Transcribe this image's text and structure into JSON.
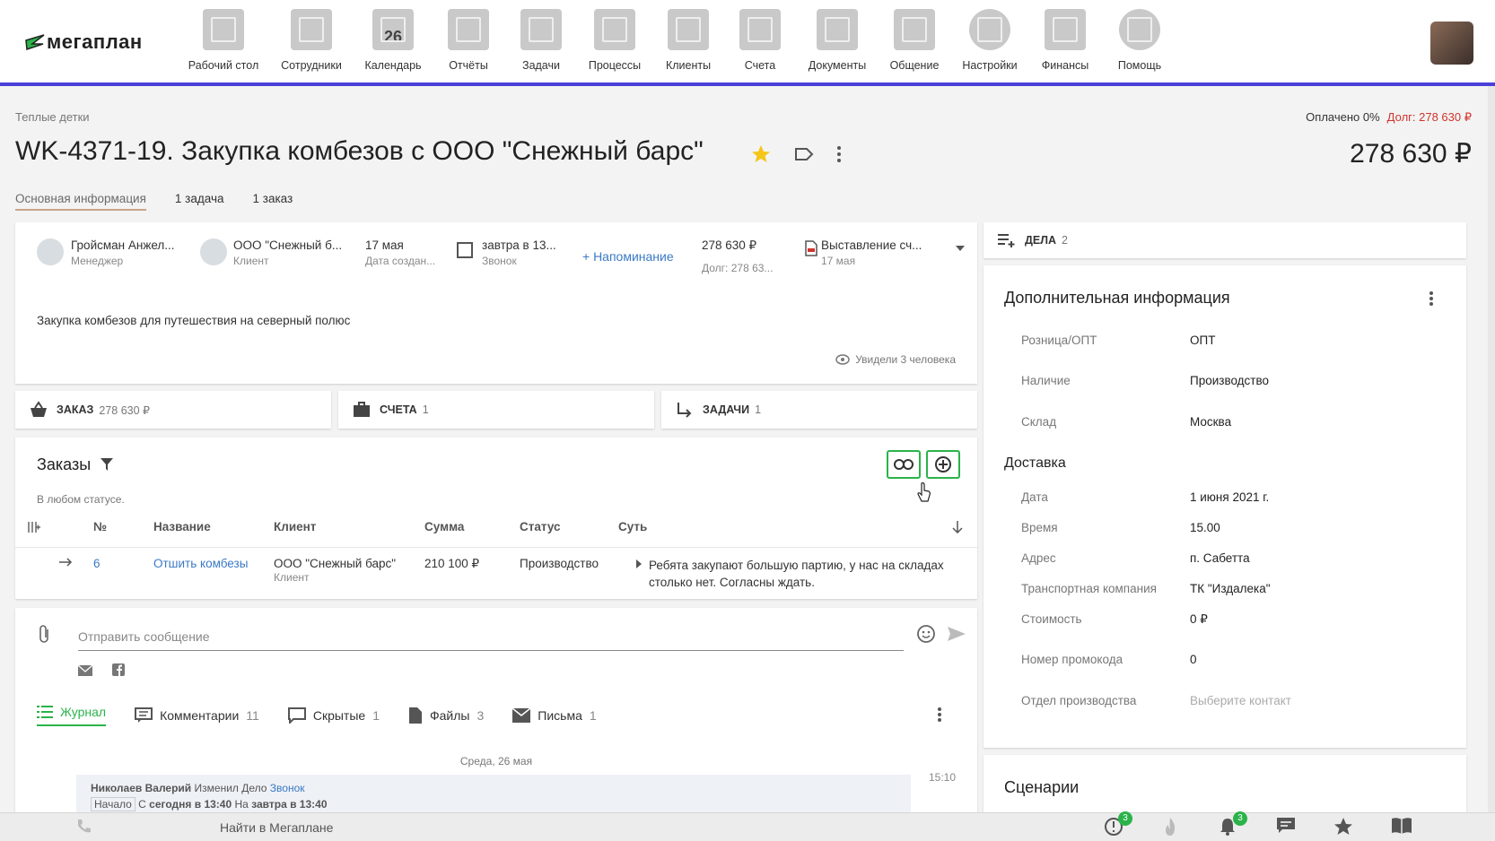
{
  "logo": {
    "text": "мегаплан"
  },
  "nav": [
    {
      "label": "Рабочий стол",
      "icon": "desktop-icon"
    },
    {
      "label": "Сотрудники",
      "icon": "employees-icon"
    },
    {
      "label": "Календарь",
      "icon": "calendar-icon",
      "day": "26"
    },
    {
      "label": "Отчёты",
      "icon": "reports-icon"
    },
    {
      "label": "Задачи",
      "icon": "tasks-icon"
    },
    {
      "label": "Процессы",
      "icon": "processes-icon"
    },
    {
      "label": "Клиенты",
      "icon": "clients-icon"
    },
    {
      "label": "Счета",
      "icon": "invoices-icon"
    },
    {
      "label": "Документы",
      "icon": "documents-icon"
    },
    {
      "label": "Общение",
      "icon": "chat-icon"
    },
    {
      "label": "Настройки",
      "icon": "settings-icon"
    },
    {
      "label": "Финансы",
      "icon": "finance-icon"
    },
    {
      "label": "Помощь",
      "icon": "help-icon"
    }
  ],
  "breadcrumb": "Теплые детки",
  "pay": {
    "paid": "Оплачено 0%",
    "debt": "Долг: 278 630 ₽"
  },
  "deal": {
    "title": "WK-4371-19. Закупка комбезов с ООО \"Снежный барс\"",
    "total": "278 630 ₽"
  },
  "tabs": [
    "Основная информация",
    "1 задача",
    "1 заказ"
  ],
  "summary": {
    "manager_name": "Гройсман Анжел...",
    "manager_role": "Менеджер",
    "client_name": "ООО \"Снежный б...",
    "client_role": "Клиент",
    "created": "17 мая",
    "created_label": "Дата создан...",
    "call": "завтра в 13...",
    "call_label": "Звонок",
    "reminder": "+ Напоминание",
    "amount": "278 630 ₽",
    "amount_debt": "Долг: 278 63...",
    "stage": "Выставление сч...",
    "stage_date": "17 мая",
    "description": "Закупка комбезов для путешествия на северный полюс",
    "seen": "Увидели 3 человека"
  },
  "blocks": [
    {
      "label": "ЗАКАЗ",
      "count": "278 630 ₽"
    },
    {
      "label": "СЧЕТА",
      "count": "1"
    },
    {
      "label": "ЗАДАЧИ",
      "count": "1"
    }
  ],
  "orders": {
    "title": "Заказы",
    "filter_text": "В любом статусе.",
    "columns": [
      "№",
      "Название",
      "Клиент",
      "Сумма",
      "Статус",
      "Суть"
    ],
    "row": {
      "num": "6",
      "name": "Отшить комбезы",
      "client": "ООО \"Снежный барс\"",
      "client_role": "Клиент",
      "sum": "210 100 ₽",
      "status": "Производство",
      "essence_1": "Ребята закупают большую партию, у нас на складах",
      "essence_2": "столько нет. Согласны ждать."
    }
  },
  "message": {
    "placeholder": "Отправить сообщение",
    "tabs": [
      {
        "label": "Журнал",
        "count": ""
      },
      {
        "label": "Комментарии",
        "count": "11"
      },
      {
        "label": "Скрытые",
        "count": "1"
      },
      {
        "label": "Файлы",
        "count": "3"
      },
      {
        "label": "Письма",
        "count": "1"
      }
    ],
    "date": "Среда, 26 мая",
    "log_line1_author": "Николаев Валерий",
    "log_line1_action": "Изменил  Дело",
    "log_line1_link": "Звонок",
    "log_line2_start": "Начало",
    "log_line2_from": "С",
    "log_line2_from_val": "сегодня в 13:40",
    "log_line2_to": "На",
    "log_line2_to_val": "завтра в 13:40",
    "time": "15:10"
  },
  "deals": {
    "label": "ДЕЛА",
    "count": "2"
  },
  "extra": {
    "title": "Дополнительная информация",
    "fields": [
      {
        "label": "Розница/ОПТ",
        "value": "ОПТ"
      },
      {
        "label": "Наличие",
        "value": "Производство"
      },
      {
        "label": "Склад",
        "value": "Москва"
      }
    ],
    "delivery_title": "Доставка",
    "delivery": [
      {
        "label": "Дата",
        "value": "1 июня 2021 г."
      },
      {
        "label": "Время",
        "value": "15.00"
      },
      {
        "label": "Адрес",
        "value": "п. Сабетта"
      },
      {
        "label": "Транспортная компания",
        "value": "ТК \"Издалека\""
      },
      {
        "label": "Стоимость",
        "value": "0 ₽"
      }
    ],
    "promo_label": "Номер промокода",
    "promo_value": "0",
    "prod_label": "Отдел производства",
    "prod_value": "Выберите контакт"
  },
  "scenarios": {
    "title": "Сценарии"
  },
  "bottom": {
    "search": "Найти в Мегаплане",
    "badge_alerts": "3",
    "badge_notifications": "3"
  }
}
